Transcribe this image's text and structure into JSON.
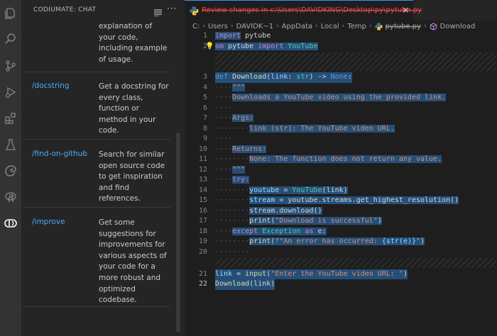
{
  "sidebar": {
    "title": "CODIUMATE: CHAT",
    "commands": [
      {
        "name": "",
        "description": "explanation of your code, including example of usage."
      },
      {
        "name": "/docstring",
        "description": "Get a docstring for every class, function or method in your code."
      },
      {
        "name": "/find-on-github",
        "description": "Search for similar open source code to get inspiration and find references."
      },
      {
        "name": "/improve",
        "description": "Get some suggestions for improvements for various aspects of your code for a more robust and optimized codebase."
      }
    ]
  },
  "tab": {
    "label": "Review changes in c:\\Users\\DAVIDKING\\Desktop\\py\\pytube.py",
    "close": "×"
  },
  "breadcrumb": [
    "C:",
    "Users",
    "DAVIDK~1",
    "AppData",
    "Local",
    "Temp",
    "pytube.py",
    "Download"
  ],
  "code": {
    "ln1": "1",
    "ln2": "2",
    "ln3": "3",
    "ln4": "4",
    "ln5": "5",
    "ln6": "6",
    "ln7": "7",
    "ln8": "8",
    "ln9": "9",
    "ln10": "10",
    "ln11": "11",
    "ln12": "12",
    "ln13": "13",
    "ln14": "14",
    "ln15": "15",
    "ln16": "16",
    "ln17": "17",
    "ln18": "18",
    "ln19": "19",
    "ln20": "20",
    "ln21": "21",
    "ln22": "22",
    "l1_kw": "import",
    "l1_mod": " pytube",
    "l2_kw": "om",
    "l2_mod": " pytube ",
    "l2_kw2": "import",
    "l2_cls": " YouTube",
    "l3_def": "def",
    "l3_fn": " Download",
    "l3_p1": "(",
    "l3_arg": "link",
    "l3_p2": ": ",
    "l3_type": "str",
    "l3_p3": ") -> ",
    "l3_none": "None",
    "l3_p4": ":",
    "l4": "\"\"\"",
    "l5": "Downloads a YouTube video using the provided link.",
    "l7": "Args:",
    "l8": "link (str): The YouTube video URL.",
    "l10": "Returns:",
    "l11": "None: The function does not return any value.",
    "l12": "\"\"\"",
    "l13": "try:",
    "l14_var": "youtube",
    "l14_eq": " = ",
    "l14_cls": "YouTube",
    "l14_rest": "(link)",
    "l15_var": "stream",
    "l15_eq": " = ",
    "l15_rest": "youtube.streams.get_highest_resolution()",
    "l16": "stream.download()",
    "l17_fn": "print",
    "l17_p": "(",
    "l17_str": "\"Download is successful\"",
    "l17_e": ")",
    "l18_kw": "except",
    "l18_cls": " Exception",
    "l18_as": " as",
    "l18_e": " e:",
    "l19_fn": "print",
    "l19_p": "(",
    "l19_f": "f",
    "l19_str": "\"An error has occurred: ",
    "l19_br": "{str(e)}",
    "l19_q": "\"",
    "l19_end": ")",
    "l21_var": "link",
    "l21_eq": " = ",
    "l21_fn": "input",
    "l21_p": "(",
    "l21_str": "\"Enter the YouTube video URL: \"",
    "l21_end": ")",
    "l22_fn": "Download",
    "l22_rest": "(link)"
  },
  "colors": {
    "accent": "#3794ff",
    "link": "#4daafc",
    "deleted_tab": "#f14c4c",
    "selection": "#264f78"
  }
}
